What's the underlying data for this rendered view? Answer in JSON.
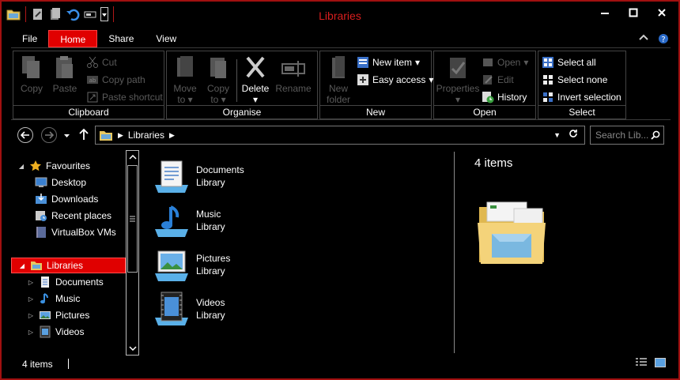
{
  "window": {
    "title": "Libraries",
    "accent": "#e00000",
    "title_color": "#d81e1e"
  },
  "ribbon_tabs": [
    {
      "label": "File"
    },
    {
      "label": "Home"
    },
    {
      "label": "Share"
    },
    {
      "label": "View"
    }
  ],
  "ribbon": {
    "clipboard": {
      "label": "Clipboard",
      "copy": "Copy",
      "paste": "Paste",
      "cut": "Cut",
      "copy_path": "Copy path",
      "paste_shortcut": "Paste shortcut"
    },
    "organise": {
      "label": "Organise",
      "move_to": "Move",
      "move_to2": "to",
      "copy_to": "Copy",
      "copy_to2": "to",
      "delete": "Delete",
      "rename": "Rename"
    },
    "new": {
      "label": "New",
      "new_folder": "New",
      "new_folder2": "folder",
      "new_item": "New item",
      "easy_access": "Easy access"
    },
    "open": {
      "label": "Open",
      "properties": "Properties",
      "open": "Open",
      "edit": "Edit",
      "history": "History"
    },
    "select": {
      "label": "Select",
      "select_all": "Select all",
      "select_none": "Select none",
      "invert": "Invert selection"
    }
  },
  "address": {
    "path": "Libraries",
    "search_placeholder": "Search Lib..."
  },
  "nav": {
    "favourites": "Favourites",
    "fav_items": [
      "Desktop",
      "Downloads",
      "Recent places",
      "VirtualBox VMs"
    ],
    "libraries": "Libraries",
    "lib_items": [
      "Documents",
      "Music",
      "Pictures",
      "Videos"
    ]
  },
  "content": {
    "items": [
      {
        "name": "Documents",
        "type": "Library"
      },
      {
        "name": "Music",
        "type": "Library"
      },
      {
        "name": "Pictures",
        "type": "Library"
      },
      {
        "name": "Videos",
        "type": "Library"
      }
    ]
  },
  "details": {
    "count": "4 items"
  },
  "status": {
    "count": "4 items"
  }
}
